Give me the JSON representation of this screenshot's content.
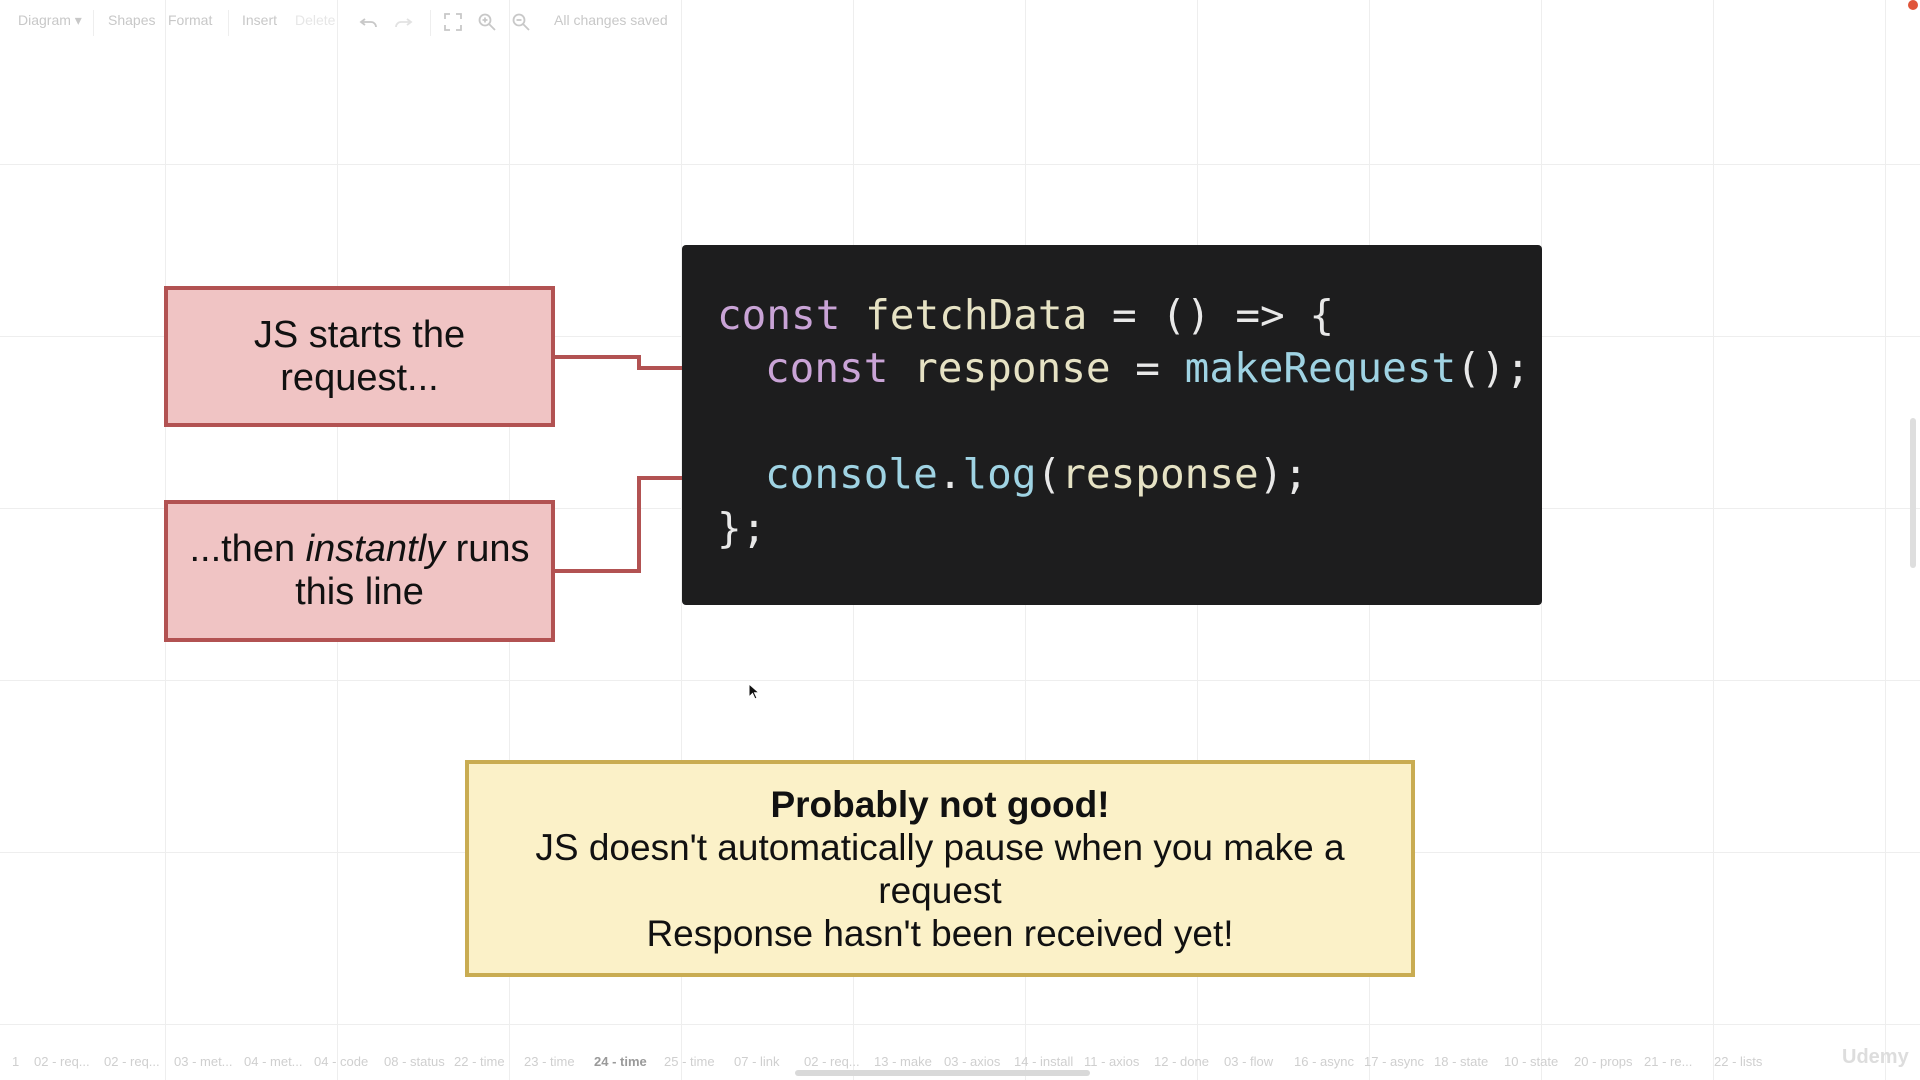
{
  "toolbar": {
    "diagram_menu": "Diagram",
    "shapes": "Shapes",
    "format": "Format",
    "insert": "Insert",
    "delete": "Delete",
    "status": "All changes saved"
  },
  "notes": {
    "first": "JS starts the request...",
    "second_before": "...then ",
    "second_emphasis": "instantly",
    "second_after": " runs this line"
  },
  "code": {
    "line1": {
      "kw": "const",
      "name": " fetchData ",
      "rest": "= () => {"
    },
    "line2": {
      "kw": "const",
      "name": " response ",
      "eq": "= ",
      "fn": "makeRequest",
      "rest": "();"
    },
    "line3": {
      "obj": "console",
      "dot": ".",
      "fn": "log",
      "open": "(",
      "arg": "response",
      "close": ");"
    },
    "line4": "};"
  },
  "warning": {
    "title": "Probably not good!",
    "line1": "JS doesn't automatically pause when you make a request",
    "line2": "Response hasn't been received yet!"
  },
  "tabs": [
    "1",
    "02 - req...",
    "02 - req...",
    "03 - met...",
    "04 - met...",
    "04 - code",
    "08 - status",
    "22 - time",
    "23 - time",
    "24 - time",
    "25 - time",
    "07 - link",
    "02 - req...",
    "13 - make",
    "03 - axios",
    "14 - install",
    "11 - axios",
    "12 - done",
    "03 - flow",
    "16 - async",
    "17 - async",
    "18 - state",
    "10 - state",
    "20 - props",
    "21 - re...",
    "22 - lists"
  ],
  "active_tab": "24 - time",
  "watermark": "Udemy",
  "colors": {
    "note_fill": "#f0c4c4",
    "note_border": "#b25252",
    "warning_fill": "#fbf1c8",
    "warning_border": "#c9ac52",
    "code_bg": "#1d1d1e",
    "arrow": "#b25252"
  }
}
